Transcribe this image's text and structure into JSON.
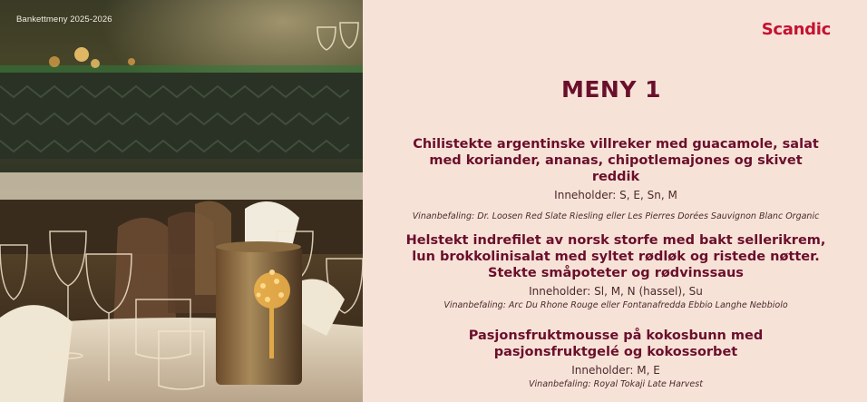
{
  "photo": {
    "caption": "Bankettmeny 2025-2026"
  },
  "brand": {
    "logo": "Scandic",
    "color": "#c41230"
  },
  "menu": {
    "title": "MENY 1",
    "courses": [
      {
        "dish": "Chilistekte argentinske villreker med guacamole, salat med koriander, ananas, chipotlemajones og skivet reddik",
        "allergens": "Inneholder: S, E, Sn, M",
        "wine": "Vinanbefaling: Dr. Loosen Red Slate Riesling eller Les Pierres Dorées Sauvignon Blanc Organic"
      },
      {
        "dish": "Helstekt indrefilet av norsk storfe med bakt sellerikrem, lun brokkolinisalat med syltet rødløk og ristede nøtter. Stekte småpoteter og rødvinssaus",
        "allergens": "Inneholder: Sl, M, N (hassel), Su",
        "wine": "Vinanbefaling: Arc Du Rhone Rouge eller Fontanafredda Ebbio Langhe Nebbiolo"
      },
      {
        "dish": "Pasjonsfruktmousse på kokosbunn med pasjonsfruktgelé og kokossorbet",
        "allergens": "Inneholder: M, E",
        "wine": "Vinanbefaling: Royal Tokaji Late Harvest"
      }
    ]
  }
}
